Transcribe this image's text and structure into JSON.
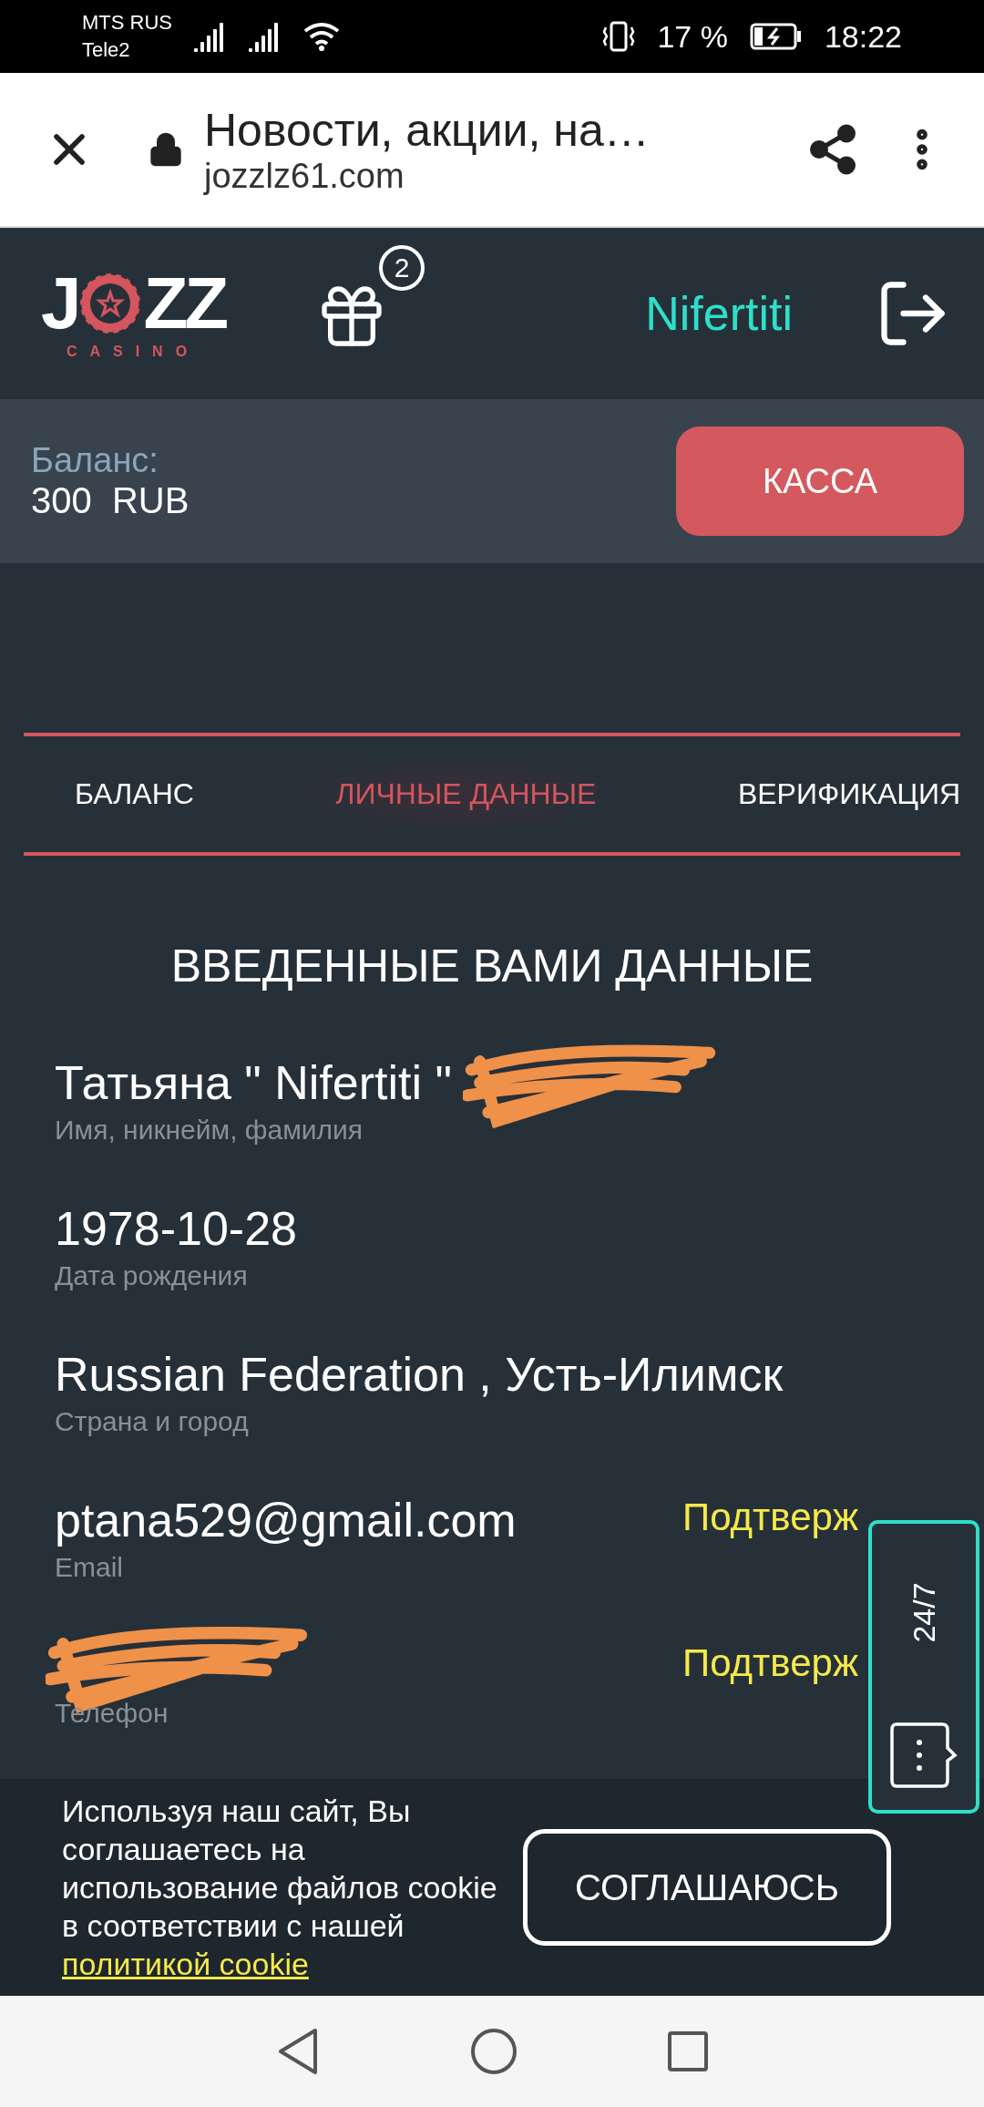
{
  "status_bar": {
    "carriers": [
      "MTS RUS",
      "Tele2"
    ],
    "battery": "17 %",
    "time": "18:22"
  },
  "browser": {
    "title": "Новости, акции, на…",
    "url": "jozzlz61.com"
  },
  "header": {
    "logo": {
      "before": "J",
      "after": "ZZ",
      "subtitle": "CASINO"
    },
    "gift_count": "2",
    "username": "Nifertiti"
  },
  "balance": {
    "label": "Баланс:",
    "amount": "300  RUB",
    "button": "КАССА"
  },
  "tabs": [
    {
      "label": "БАЛАНС",
      "selected": false
    },
    {
      "label": "ЛИЧНЫЕ ДАННЫЕ",
      "selected": true
    },
    {
      "label": "ВЕРИФИКАЦИЯ",
      "selected": false
    }
  ],
  "section_title": "ВВЕДЕННЫЕ ВАМИ ДАННЫЕ",
  "fields": [
    {
      "value": "Татьяна \" Nifertiti \"",
      "label": "Имя, никнейм, фамилия",
      "redacted": true
    },
    {
      "value": "1978-10-28",
      "label": "Дата рождения"
    },
    {
      "value": "Russian Federation , Усть-Илимск",
      "label": "Страна и город"
    },
    {
      "value": "ptana529@gmail.com",
      "label": "Email",
      "status": "Подтверж"
    },
    {
      "label": "Телефон",
      "status": "Подтверж",
      "redacted": true
    }
  ],
  "chat_widget": {
    "label": "24/7"
  },
  "cookie_banner": {
    "text": "Используя наш сайт, Вы соглашаетесь на использование файлов cookie в соответствии с нашей",
    "link": "политикой cookie",
    "button": "СОГЛАШАЮСЬ"
  }
}
